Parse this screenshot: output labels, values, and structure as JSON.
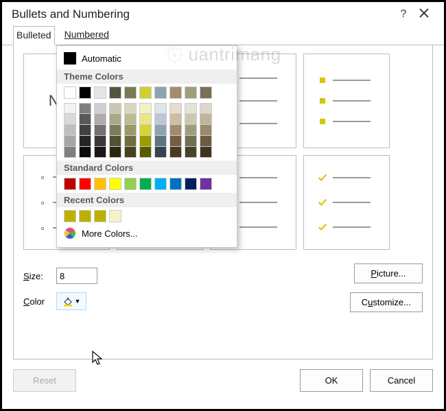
{
  "window": {
    "title": "Bullets and Numbering"
  },
  "tabs": {
    "bulleted": "Bulleted",
    "numbered": "Numbered"
  },
  "controls": {
    "size_label": "Size:",
    "size_value": "8",
    "color_label": "Color",
    "picture_btn": "Picture...",
    "customize_btn": "Customize...",
    "reset_btn": "Reset",
    "ok_btn": "OK",
    "cancel_btn": "Cancel"
  },
  "colorpicker": {
    "automatic": "Automatic",
    "theme_heading": "Theme Colors",
    "standard_heading": "Standard Colors",
    "recent_heading": "Recent Colors",
    "more": "More Colors...",
    "theme_row": [
      "#ffffff",
      "#000000",
      "#e7e6e6",
      "#555440",
      "#7a7a52",
      "#cfcf33",
      "#8ea2b0",
      "#a38b6d",
      "#9e9e7f",
      "#7a6e58"
    ],
    "theme_shades": [
      [
        "#f2f2f2",
        "#d9d9d9",
        "#bfbfbf",
        "#a6a6a6",
        "#808080"
      ],
      [
        "#7f7f7f",
        "#595959",
        "#404040",
        "#262626",
        "#0d0d0d"
      ],
      [
        "#d0cece",
        "#aeabab",
        "#757070",
        "#3b3838",
        "#1a1716"
      ],
      [
        "#c9c7b6",
        "#a9a68a",
        "#7e7b5c",
        "#52502f",
        "#29280f"
      ],
      [
        "#d8d8c0",
        "#bcbc94",
        "#9a996a",
        "#6f6e3e",
        "#45441f"
      ],
      [
        "#f3f3c2",
        "#e8e88a",
        "#d6d633",
        "#9c9c00",
        "#5a5a00"
      ],
      [
        "#dde4ea",
        "#bcc9d4",
        "#8ea2b0",
        "#5f7483",
        "#37444e"
      ],
      [
        "#e6ddcf",
        "#cfbda0",
        "#a38b6d",
        "#745f42",
        "#48391f"
      ],
      [
        "#e3e3d6",
        "#c9c9af",
        "#9e9e7f",
        "#707052",
        "#444428"
      ],
      [
        "#ddd7ca",
        "#bfb49d",
        "#998a6d",
        "#6b5d42",
        "#3f351f"
      ]
    ],
    "standard_row": [
      "#c00000",
      "#ff0000",
      "#ffc000",
      "#ffff00",
      "#92d050",
      "#00b050",
      "#00b0f0",
      "#0070c0",
      "#002060",
      "#7030a0"
    ],
    "recent_row": [
      "#bdb000",
      "#bdb000",
      "#bdb000",
      "#f5f3c7"
    ]
  },
  "watermark": {
    "text": "uantrimang"
  },
  "preview": {
    "none_label": "None"
  }
}
